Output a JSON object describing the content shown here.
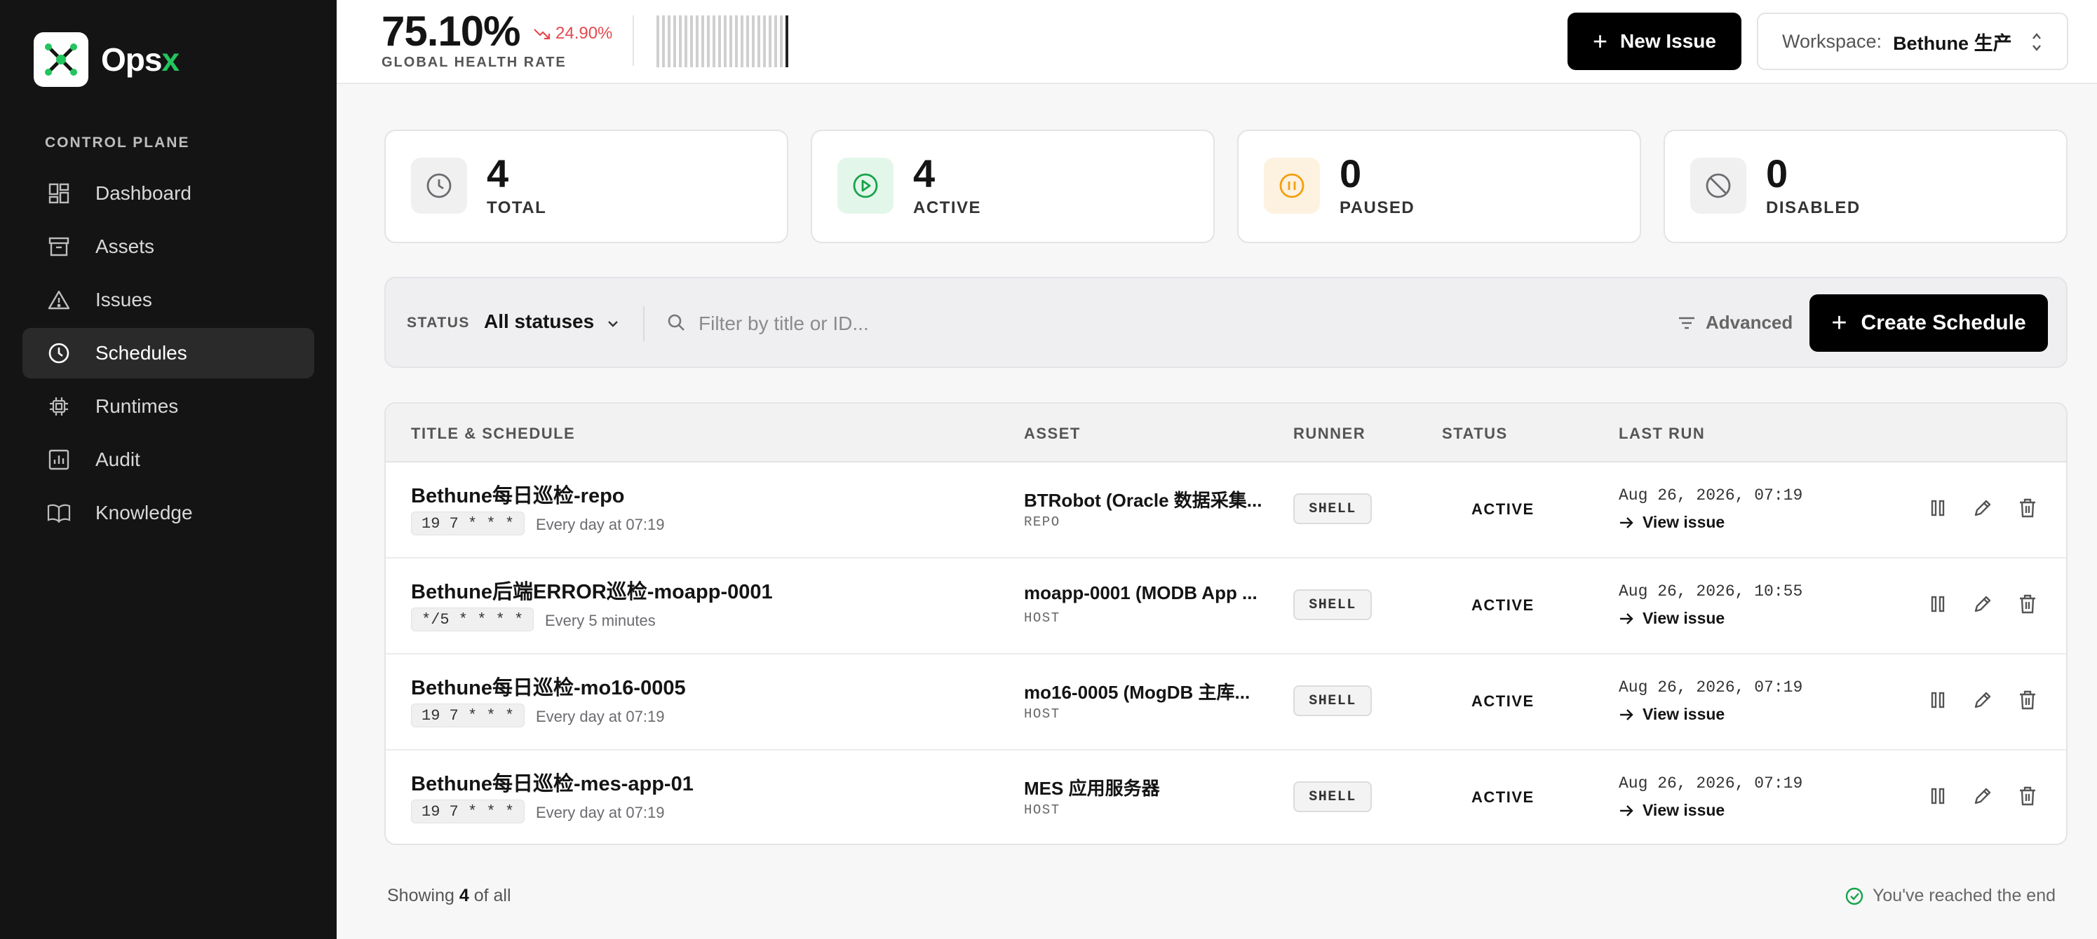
{
  "brand": {
    "name_main": "Ops",
    "name_accent": "x"
  },
  "sidebar": {
    "section_label": "CONTROL PLANE",
    "items": [
      {
        "label": "Dashboard",
        "icon": "dashboard-icon",
        "active": false
      },
      {
        "label": "Assets",
        "icon": "archive-icon",
        "active": false
      },
      {
        "label": "Issues",
        "icon": "warning-triangle-icon",
        "active": false
      },
      {
        "label": "Schedules",
        "icon": "clock-icon",
        "active": true
      },
      {
        "label": "Runtimes",
        "icon": "chip-icon",
        "active": false
      },
      {
        "label": "Audit",
        "icon": "bar-chart-icon",
        "active": false
      },
      {
        "label": "Knowledge",
        "icon": "book-icon",
        "active": false
      }
    ]
  },
  "header": {
    "health_value": "75.10%",
    "health_delta": "24.90%",
    "health_label": "GLOBAL HEALTH RATE",
    "new_issue_label": "New Issue",
    "workspace_label": "Workspace:",
    "workspace_value": "Bethune 生产"
  },
  "stats": [
    {
      "value": "4",
      "label": "TOTAL",
      "icon": "clock-icon",
      "color": "#6b6b70",
      "bg": "#f0f0f1"
    },
    {
      "value": "4",
      "label": "ACTIVE",
      "icon": "play-circle-icon",
      "color": "#16a34a",
      "bg": "#e3f6ea"
    },
    {
      "value": "0",
      "label": "PAUSED",
      "icon": "pause-circle-icon",
      "color": "#f59e0b",
      "bg": "#fdf1e0"
    },
    {
      "value": "0",
      "label": "DISABLED",
      "icon": "ban-icon",
      "color": "#6b6b70",
      "bg": "#f0f0f1"
    }
  ],
  "filters": {
    "status_label": "STATUS",
    "status_value": "All statuses",
    "search_placeholder": "Filter by title or ID...",
    "advanced_label": "Advanced",
    "create_label": "Create Schedule"
  },
  "table": {
    "columns": [
      "TITLE & SCHEDULE",
      "ASSET",
      "RUNNER",
      "STATUS",
      "LAST RUN"
    ],
    "rows": [
      {
        "title": "Bethune每日巡检-repo",
        "cron": "19 7 * * *",
        "human": "Every day at 07:19",
        "asset": "BTRobot (Oracle 数据采集...",
        "asset_type": "REPO",
        "runner": "SHELL",
        "status": "ACTIVE",
        "last_run": "Aug 26, 2026, 07:19",
        "view": "View issue"
      },
      {
        "title": "Bethune后端ERROR巡检-moapp-0001",
        "cron": "*/5 * * * *",
        "human": "Every 5 minutes",
        "asset": "moapp-0001 (MODB App ...",
        "asset_type": "HOST",
        "runner": "SHELL",
        "status": "ACTIVE",
        "last_run": "Aug 26, 2026, 10:55",
        "view": "View issue"
      },
      {
        "title": "Bethune每日巡检-mo16-0005",
        "cron": "19 7 * * *",
        "human": "Every day at 07:19",
        "asset": "mo16-0005 (MogDB 主库...",
        "asset_type": "HOST",
        "runner": "SHELL",
        "status": "ACTIVE",
        "last_run": "Aug 26, 2026, 07:19",
        "view": "View issue"
      },
      {
        "title": "Bethune每日巡检-mes-app-01",
        "cron": "19 7 * * *",
        "human": "Every day at 07:19",
        "asset": "MES 应用服务器",
        "asset_type": "HOST",
        "runner": "SHELL",
        "status": "ACTIVE",
        "last_run": "Aug 26, 2026, 07:19",
        "view": "View issue"
      }
    ]
  },
  "footer": {
    "showing_prefix": "Showing",
    "showing_count": "4",
    "showing_suffix": "of all",
    "end_text": "You've reached the end"
  }
}
